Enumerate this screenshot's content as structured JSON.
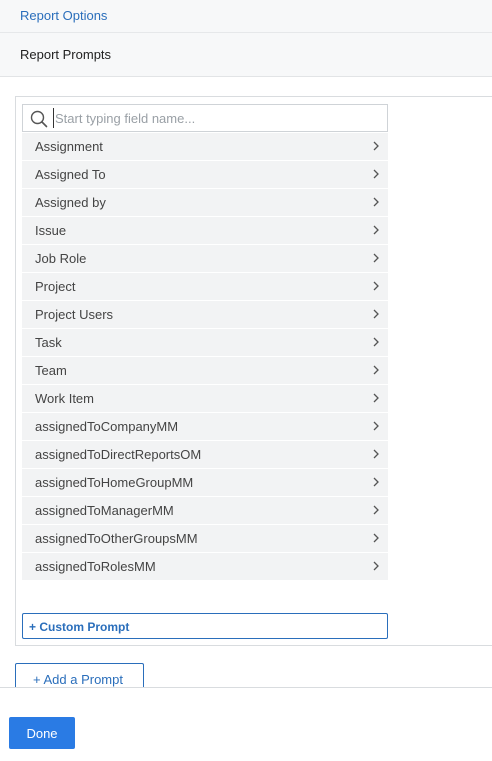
{
  "header": {
    "report_options_link": "Report Options"
  },
  "section": {
    "title": "Report Prompts"
  },
  "search": {
    "placeholder": "Start typing field name...",
    "value": "",
    "icon": "search-icon"
  },
  "fields": {
    "items": [
      {
        "label": "Assignment"
      },
      {
        "label": "Assigned To"
      },
      {
        "label": "Assigned by"
      },
      {
        "label": "Issue"
      },
      {
        "label": "Job Role"
      },
      {
        "label": "Project"
      },
      {
        "label": "Project Users"
      },
      {
        "label": "Task"
      },
      {
        "label": "Team"
      },
      {
        "label": "Work Item"
      },
      {
        "label": "assignedToCompanyMM"
      },
      {
        "label": "assignedToDirectReportsOM"
      },
      {
        "label": "assignedToHomeGroupMM"
      },
      {
        "label": "assignedToManagerMM"
      },
      {
        "label": "assignedToOtherGroupsMM"
      },
      {
        "label": "assignedToRolesMM"
      }
    ],
    "item_icon": "chevron-right-icon"
  },
  "actions": {
    "custom_prompt_label": "+ Custom Prompt",
    "add_prompt_label": "+ Add a Prompt",
    "done_label": "Done"
  },
  "colors": {
    "accent": "#2a6ebb",
    "primary_button": "#2a7be4",
    "list_item_bg": "#f2f3f4"
  }
}
